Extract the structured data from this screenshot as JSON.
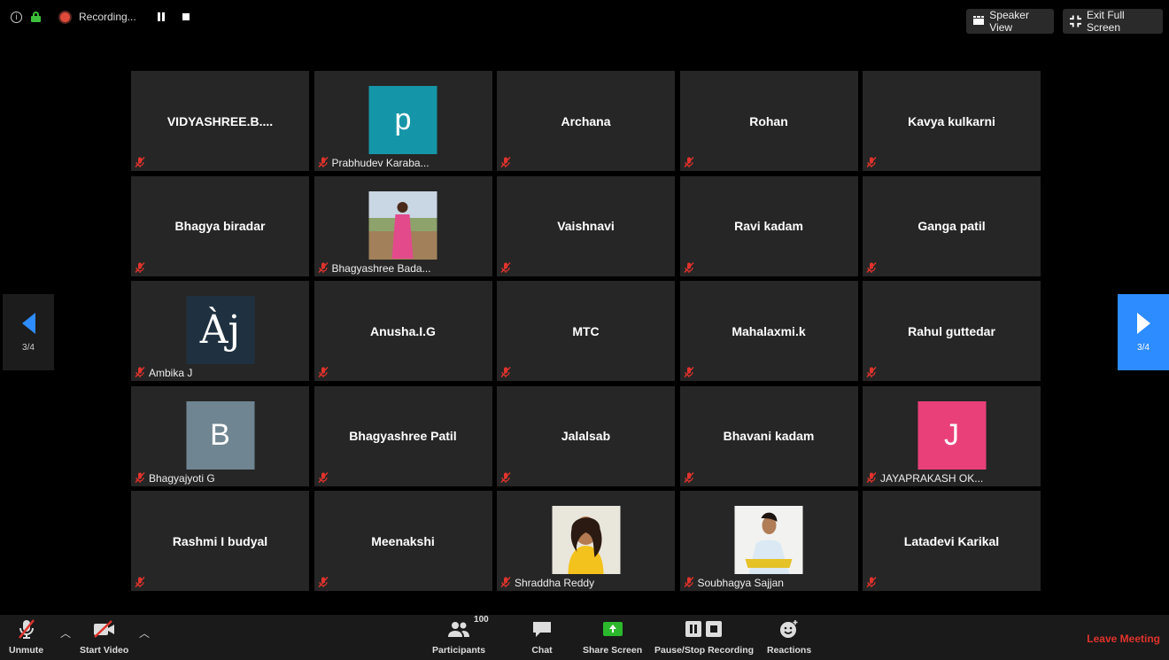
{
  "topbar": {
    "recording_label": "Recording...",
    "speaker_view_label": "Speaker View",
    "exit_fullscreen_label": "Exit Full Screen"
  },
  "pager": {
    "left_label": "3/4",
    "right_label": "3/4"
  },
  "tiles": [
    {
      "name": "VIDYASHREE.B....",
      "style": "center"
    },
    {
      "name": "Prabhudev Karaba...",
      "style": "avatar",
      "initial": "p",
      "color": "#1596a8"
    },
    {
      "name": "Archana",
      "style": "center"
    },
    {
      "name": "Rohan",
      "style": "center"
    },
    {
      "name": "Kavya kulkarni",
      "style": "center"
    },
    {
      "name": "Bhagya biradar",
      "style": "center"
    },
    {
      "name": "Bhagyashree Bada...",
      "style": "photo"
    },
    {
      "name": "Vaishnavi",
      "style": "center"
    },
    {
      "name": "Ravi kadam",
      "style": "center"
    },
    {
      "name": "Ganga patil",
      "style": "center"
    },
    {
      "name": "Ambika J",
      "style": "avatar",
      "initial": "Àj",
      "color": "#1f3140"
    },
    {
      "name": "Anusha.I.G",
      "style": "center"
    },
    {
      "name": "MTC",
      "style": "center"
    },
    {
      "name": "Mahalaxmi.k",
      "style": "center"
    },
    {
      "name": "Rahul guttedar",
      "style": "center"
    },
    {
      "name": "Bhagyajyoti G",
      "style": "avatar",
      "initial": "B",
      "color": "#6f8591"
    },
    {
      "name": "Bhagyashree Patil",
      "style": "center"
    },
    {
      "name": "Jalalsab",
      "style": "center"
    },
    {
      "name": "Bhavani kadam",
      "style": "center"
    },
    {
      "name": "JAYAPRAKASH OK...",
      "style": "avatar",
      "initial": "J",
      "color": "#e9407a"
    },
    {
      "name": "Rashmi I budyal",
      "style": "center"
    },
    {
      "name": "Meenakshi",
      "style": "center"
    },
    {
      "name": "Shraddha Reddy",
      "style": "photo"
    },
    {
      "name": "Soubhagya Sajjan",
      "style": "photo"
    },
    {
      "name": "Latadevi Karikal",
      "style": "center"
    }
  ],
  "toolbar": {
    "unmute_label": "Unmute",
    "start_video_label": "Start Video",
    "participants_label": "Participants",
    "participants_count": "100",
    "chat_label": "Chat",
    "share_screen_label": "Share Screen",
    "recording_label": "Pause/Stop Recording",
    "reactions_label": "Reactions",
    "leave_label": "Leave Meeting"
  },
  "colors": {
    "accent": "#2d8cff",
    "leave": "#e0332c",
    "share": "#2cb82c",
    "tile_bg": "#262626"
  }
}
